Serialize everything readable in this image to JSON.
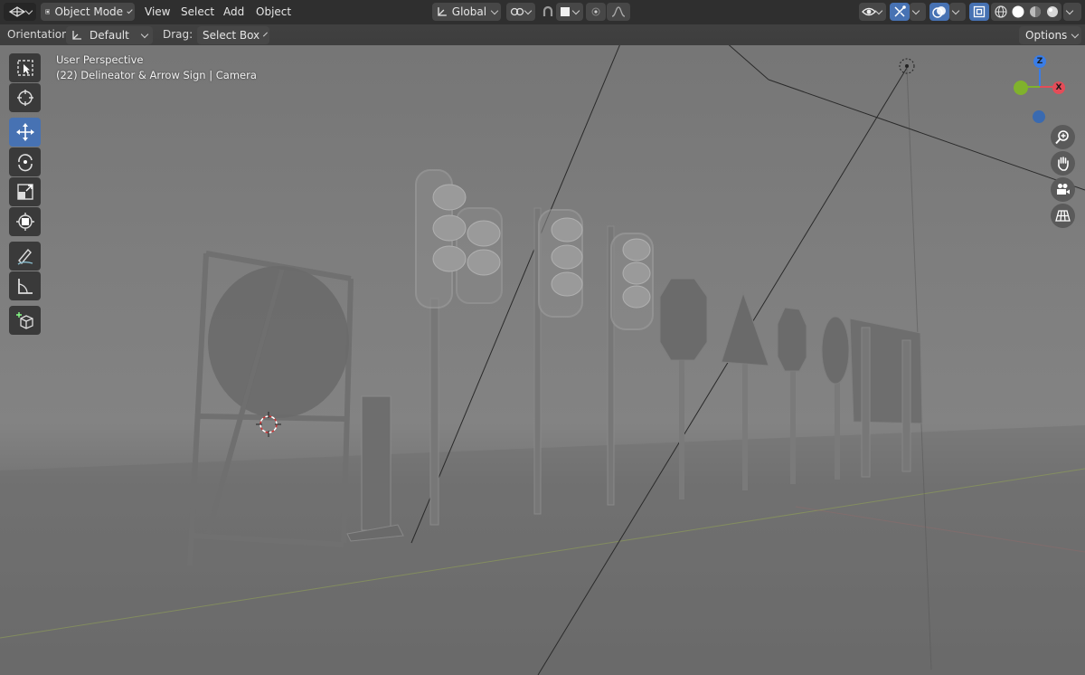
{
  "header": {
    "mode": "Object Mode",
    "menus": [
      "View",
      "Select",
      "Add",
      "Object"
    ],
    "transform_orientation": "Global",
    "icons": [
      "editor-type-icon",
      "object-mode-icon",
      "transform-pivot-icon",
      "snap-link-icon",
      "snap-magnet-icon",
      "snap-increment-icon",
      "proportional-edit-icon",
      "falloff-curve-icon",
      "visibility-icon",
      "gizmo-icon",
      "overlay-icon",
      "xray-icon",
      "wireframe-shading-icon",
      "solid-shading-icon",
      "material-shading-icon",
      "rendered-shading-icon"
    ]
  },
  "toolbar_row": {
    "orientation_label": "Orientation:",
    "orientation_value": "Default",
    "drag_label": "Drag:",
    "drag_value": "Select Box",
    "options_label": "Options"
  },
  "viewport": {
    "perspective": "User Perspective",
    "object_info": "(22) Delineator & Arrow Sign | Camera"
  },
  "tools": [
    {
      "name": "select-box-tool",
      "active": false
    },
    {
      "name": "cursor-tool",
      "active": false
    },
    {
      "name": "move-tool",
      "active": true
    },
    {
      "name": "rotate-tool",
      "active": false
    },
    {
      "name": "scale-tool",
      "active": false
    },
    {
      "name": "transform-tool",
      "active": false
    },
    {
      "name": "annotate-tool",
      "active": false
    },
    {
      "name": "measure-tool",
      "active": false
    },
    {
      "name": "add-cube-tool",
      "active": false
    }
  ],
  "gizmo": {
    "x": "X",
    "y": "Y",
    "z": "Z"
  },
  "colors": {
    "accent": "#4772b3",
    "x_axis": "#e44c58",
    "y_axis": "#80b22c",
    "z_axis": "#3a7de6"
  }
}
